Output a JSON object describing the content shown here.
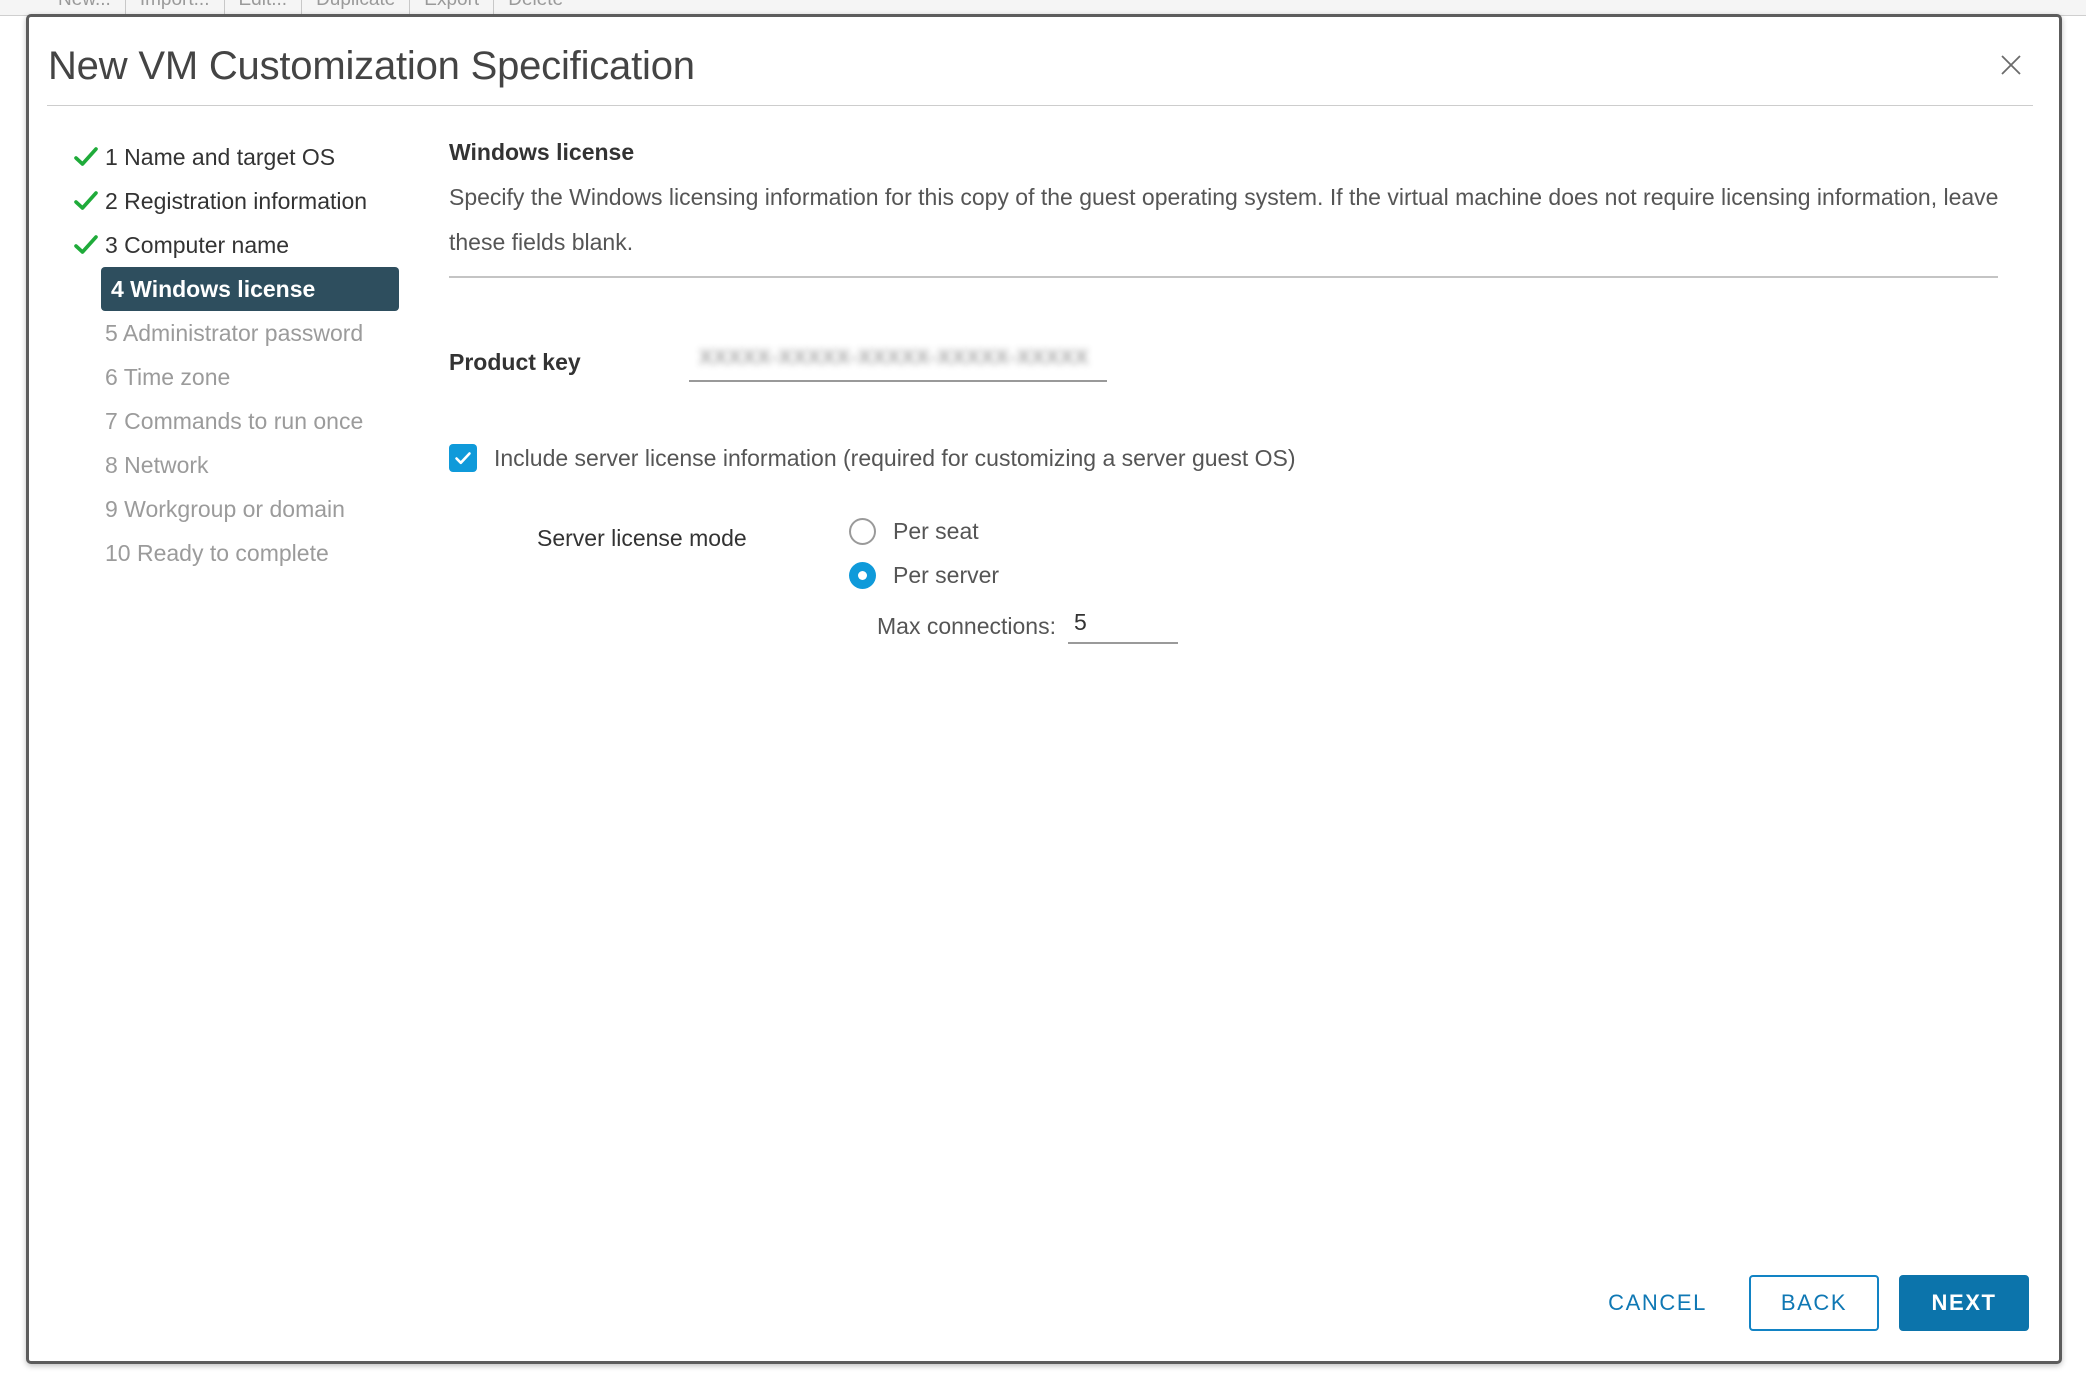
{
  "background_toolbar": {
    "items": [
      "New...",
      "Import...",
      "Edit...",
      "Duplicate",
      "Export",
      "Delete"
    ]
  },
  "dialog": {
    "title": "New VM Customization Specification",
    "close_icon": "close-icon"
  },
  "wizard": {
    "steps": [
      {
        "label": "1 Name and target OS",
        "state": "done"
      },
      {
        "label": "2 Registration information",
        "state": "done"
      },
      {
        "label": "3 Computer name",
        "state": "done"
      },
      {
        "label": "4 Windows license",
        "state": "current"
      },
      {
        "label": "5 Administrator password",
        "state": "pending"
      },
      {
        "label": "6 Time zone",
        "state": "pending"
      },
      {
        "label": "7 Commands to run once",
        "state": "pending"
      },
      {
        "label": "8 Network",
        "state": "pending"
      },
      {
        "label": "9 Workgroup or domain",
        "state": "pending"
      },
      {
        "label": "10 Ready to complete",
        "state": "pending"
      }
    ]
  },
  "main": {
    "section_title": "Windows license",
    "section_description": "Specify the Windows licensing information for this copy of the guest operating system. If the virtual machine does not require licensing information, leave these fields blank.",
    "product_key": {
      "label": "Product key",
      "value": "XXXXX-XXXXX-XXXXX-XXXXX-XXXXX",
      "placeholder": "",
      "redacted": true
    },
    "include_server_license": {
      "label": "Include server license information (required for customizing a server guest OS)",
      "checked": true
    },
    "server_license_mode": {
      "label": "Server license mode",
      "options": [
        {
          "label": "Per seat",
          "selected": false
        },
        {
          "label": "Per server",
          "selected": true
        }
      ]
    },
    "max_connections": {
      "label": "Max connections:",
      "value": "5"
    }
  },
  "footer": {
    "cancel_label": "CANCEL",
    "back_label": "BACK",
    "next_label": "NEXT"
  },
  "colors": {
    "accent_blue": "#0f9ada",
    "button_blue": "#0c74ab",
    "link_blue": "#0f78b4",
    "step_active_bg": "#2e4e5e",
    "check_green": "#1fab3a"
  }
}
